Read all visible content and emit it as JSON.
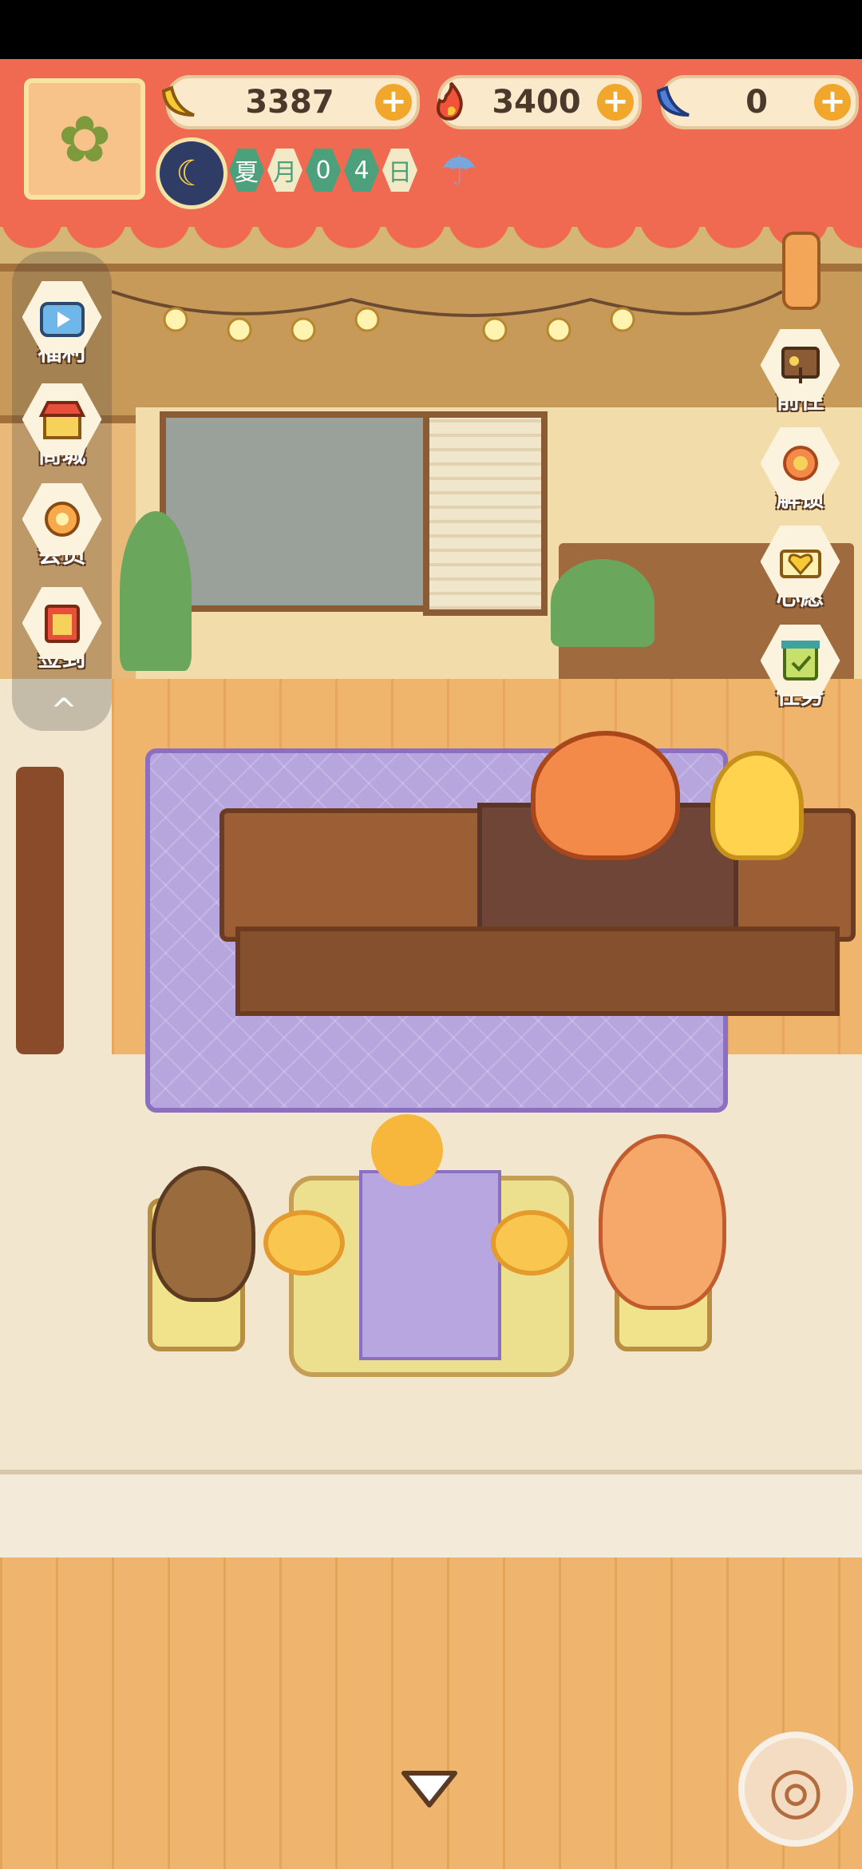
{
  "header": {
    "resources": [
      {
        "name": "banana",
        "icon": "banana-icon",
        "value": "3387",
        "plus": "+"
      },
      {
        "name": "fire-peppers",
        "icon": "fire-icon",
        "value": "3400",
        "plus": "+"
      },
      {
        "name": "blue-banana",
        "icon": "blue-banana-icon",
        "value": "0",
        "plus": "+"
      }
    ],
    "date": {
      "cells": [
        "夏",
        "月",
        "0",
        "4",
        "日"
      ]
    },
    "weather": {
      "icon": "rain-cloud-icon"
    }
  },
  "left_menu": [
    {
      "label": "福利",
      "icon": "tv-icon"
    },
    {
      "label": "商城",
      "icon": "shop-icon"
    },
    {
      "label": "会员",
      "icon": "flower-badge-icon"
    },
    {
      "label": "签到",
      "icon": "calendar-icon"
    }
  ],
  "right_menu": [
    {
      "label": "前往",
      "icon": "signboard-icon"
    },
    {
      "label": "解锁",
      "icon": "gear-badge-icon"
    },
    {
      "label": "心愿",
      "icon": "heart-book-icon"
    },
    {
      "label": "任务",
      "icon": "checklist-icon"
    }
  ],
  "colors": {
    "accent": "#ef6a50",
    "menu_text_outline": "#5b3a24",
    "date_green": "#4ca07b"
  },
  "glyphs": {
    "collapse": "^",
    "avatar": "✿",
    "yarn": "◎",
    "date": "☾",
    "weather": "☂"
  }
}
